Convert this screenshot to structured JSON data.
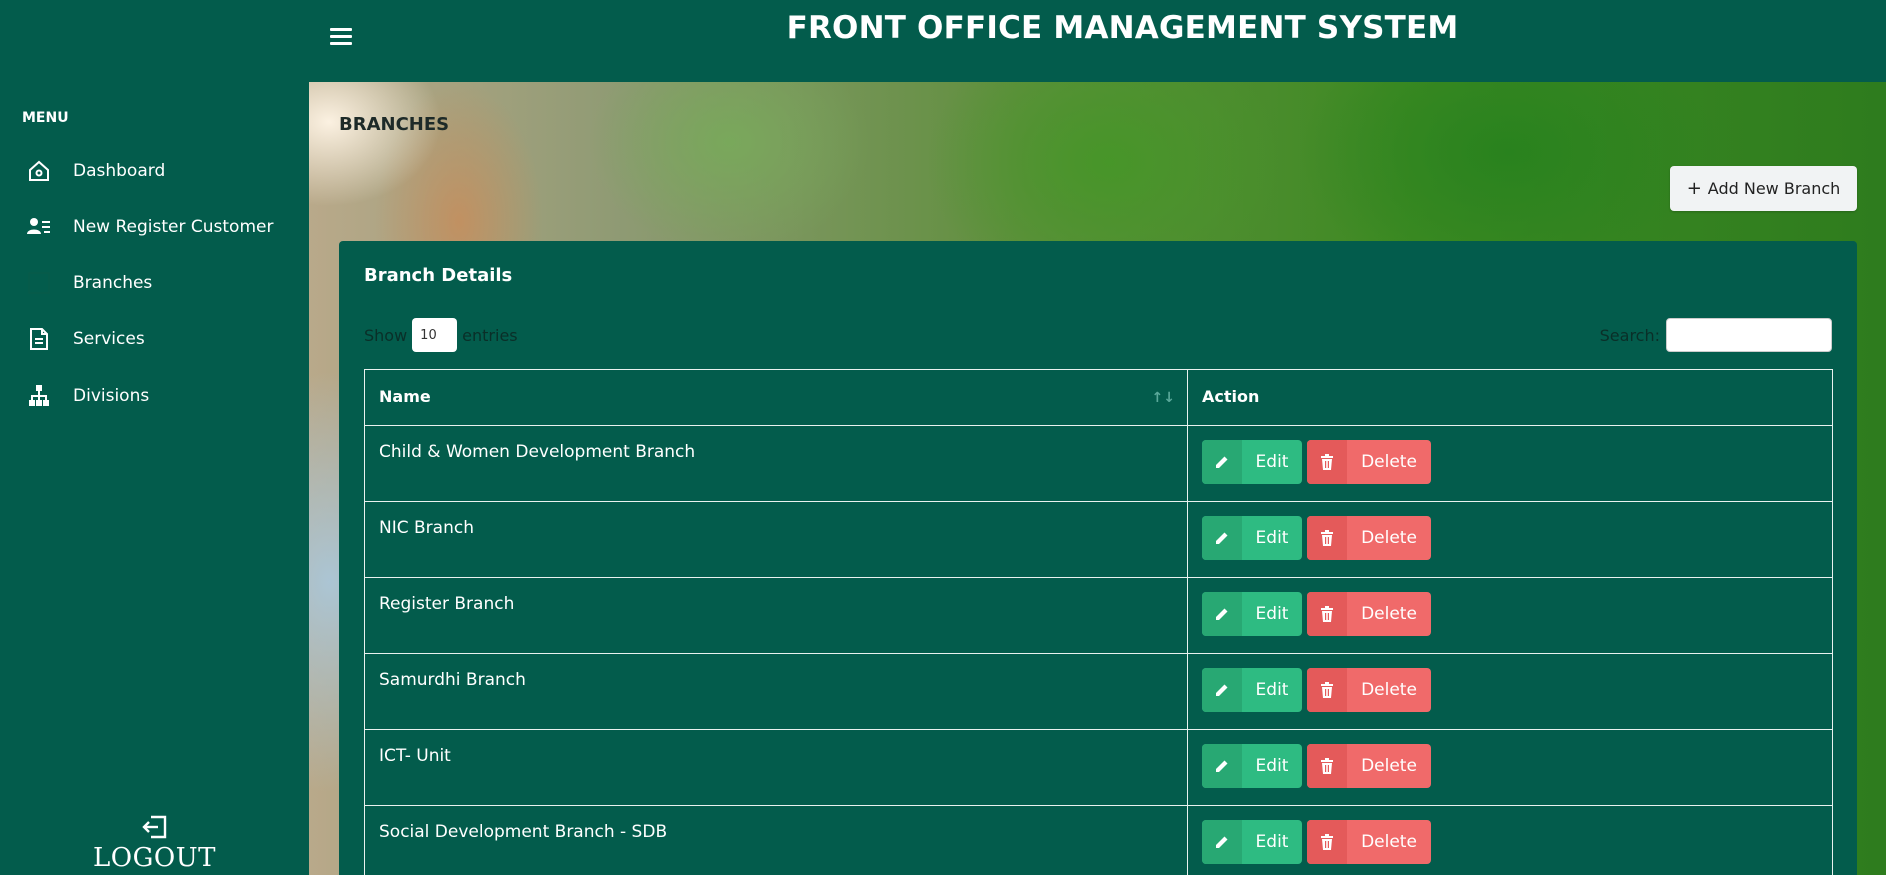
{
  "header": {
    "title": "FRONT OFFICE MANAGEMENT SYSTEM",
    "menu_icon": "hamburger-icon"
  },
  "sidebar": {
    "heading": "MENU",
    "items": [
      {
        "label": "Dashboard",
        "icon": "home-icon"
      },
      {
        "label": "New Register Customer",
        "icon": "user-list-icon"
      },
      {
        "label": "Branches",
        "icon": "branch-icon"
      },
      {
        "label": "Services",
        "icon": "document-icon"
      },
      {
        "label": "Divisions",
        "icon": "sitemap-icon"
      }
    ],
    "logout_label": "LOGOUT"
  },
  "main": {
    "page_title": "BRANCHES",
    "add_button": "Add New Branch",
    "card_title": "Branch Details",
    "length": {
      "show": "Show",
      "value": "10",
      "entries": "entries"
    },
    "search": {
      "label": "Search:",
      "value": ""
    },
    "table": {
      "headers": [
        "Name",
        "Action"
      ],
      "rows": [
        {
          "name": "Child & Women Development Branch"
        },
        {
          "name": "NIC Branch"
        },
        {
          "name": "Register Branch"
        },
        {
          "name": "Samurdhi Branch"
        },
        {
          "name": "ICT- Unit"
        },
        {
          "name": "Social Development Branch - SDB"
        }
      ],
      "edit_label": "Edit",
      "delete_label": "Delete"
    }
  },
  "colors": {
    "primary": "#035c4c",
    "edit": "#2ebb82",
    "delete": "#f06a6a"
  }
}
